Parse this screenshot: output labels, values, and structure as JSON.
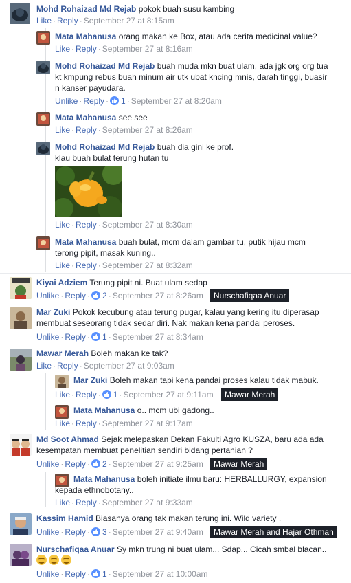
{
  "thread": [
    {
      "name": "Mohd Rohaizad Md Rejab",
      "text": "pokok buah susu kambing",
      "like": "Like",
      "reply": "Reply",
      "time": "September 27 at 8:15am"
    },
    {
      "name": "Mata Mahanusa",
      "text": "orang makan ke Box, atau ada cerita medicinal value?",
      "like": "Like",
      "reply": "Reply",
      "time": "September 27 at 8:16am"
    },
    {
      "name": "Mohd Rohaizad Md Rejab",
      "text": "buah muda mkn buat ulam, ada jgk org org tua kt kmpung rebus buah minum air utk ubat kncing mnis, darah tinggi, buasir n kanser payudara.",
      "like": "Unlike",
      "reply": "Reply",
      "count": "1",
      "time": "September 27 at 8:20am"
    },
    {
      "name": "Mata Mahanusa",
      "text": "see see",
      "like": "Like",
      "reply": "Reply",
      "time": "September 27 at 8:26am"
    },
    {
      "name": "Mohd Rohaizad Md Rejab",
      "text": "buah dia gini ke prof.",
      "text2": "klau buah bulat terung hutan tu",
      "like": "Like",
      "reply": "Reply",
      "time": "September 27 at 8:30am"
    },
    {
      "name": "Mata Mahanusa",
      "text": "buah bulat, mcm dalam gambar tu, putik hijau mcm terong pipit, masak kuning..",
      "like": "Like",
      "reply": "Reply",
      "time": "September 27 at 8:32am"
    }
  ],
  "comments": [
    {
      "name": "Kiyai Adziem",
      "text": "Terung pipit ni. Buat ulam sedap",
      "like": "Unlike",
      "reply": "Reply",
      "count": "2",
      "time": "September 27 at 8:26am",
      "tag": "Nurschafiqaa Anuar"
    },
    {
      "name": "Mar Zuki",
      "text": "Pokok kecubung atau terung pugar, kalau yang kering itu diperasap membuat seseorang tidak sedar diri. Nak makan kena pandai peroses.",
      "like": "Unlike",
      "reply": "Reply",
      "count": "1",
      "time": "September 27 at 8:34am"
    },
    {
      "name": "Mawar Merah",
      "text": "Boleh makan ke tak?",
      "like": "Like",
      "reply": "Reply",
      "time": "September 27 at 9:03am"
    },
    {
      "name": "Mar Zuki",
      "text": "Boleh makan tapi kena pandai proses kalau tidak mabuk.",
      "like": "Like",
      "reply": "Reply",
      "count": "1",
      "time": "September 27 at 9:11am",
      "tag": "Mawar Merah"
    },
    {
      "name": "Mata Mahanusa",
      "text": "o.. mcm ubi gadong..",
      "like": "Like",
      "reply": "Reply",
      "time": "September 27 at 9:17am"
    },
    {
      "name": "Md Soot Ahmad",
      "text": "Sejak melepaskan Dekan Fakulti Agro KUSZA, baru ada ada kesempatan membuat penelitian sendiri bidang pertanian ?",
      "like": "Unlike",
      "reply": "Reply",
      "count": "2",
      "time": "September 27 at 9:25am",
      "tag": "Mawar Merah"
    },
    {
      "name": "Mata Mahanusa",
      "text": "boleh initiate ilmu baru: HERBALLURGY, expansion kepada ethnobotany..",
      "like": "Like",
      "reply": "Reply",
      "time": "September 27 at 9:33am"
    },
    {
      "name": "Kassim Hamid",
      "text": "Biasanya orang tak makan terung ini. Wild variety .",
      "like": "Unlike",
      "reply": "Reply",
      "count": "3",
      "time": "September 27 at 9:40am",
      "tag": "Mawar Merah and Hajar Othman"
    },
    {
      "name": "Nurschafiqaa Anuar",
      "text": "Sy mkn trung ni buat ulam... Sdap... Cicah smbal blacan..",
      "like": "Unlike",
      "reply": "Reply",
      "count": "1",
      "time": "September 27 at 10:00am"
    }
  ],
  "separator": "·",
  "colors": {
    "link": "#4267b2",
    "name": "#365899",
    "meta": "#90949c",
    "tag_bg": "#1d2129",
    "like_badge": "#5890ff"
  }
}
